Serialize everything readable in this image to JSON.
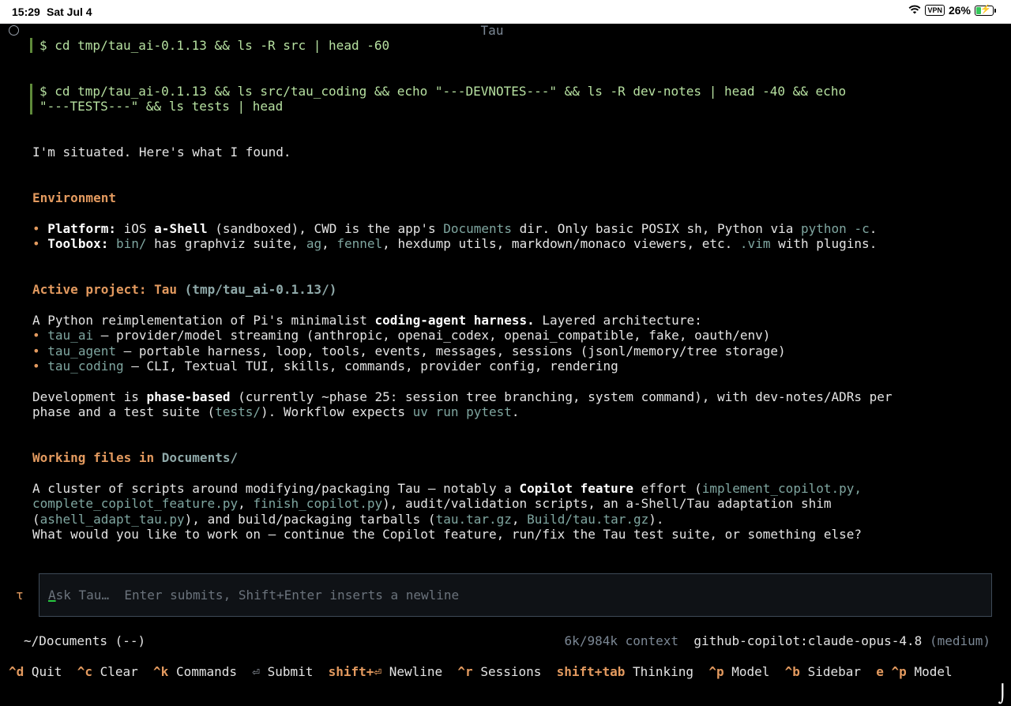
{
  "status_bar": {
    "time": "15:29",
    "date": "Sat Jul 4",
    "vpn": "VPN",
    "battery": "26%"
  },
  "window": {
    "title": "Tau"
  },
  "commands": [
    {
      "line1": "$ cd tmp/tau_ai-0.1.13 && ls -R src | head -60",
      "line2": ""
    },
    {
      "line1": "$ cd tmp/tau_ai-0.1.13 && ls src/tau_coding && echo \"---DEVNOTES---\" && ls -R dev-notes | head -40 && echo",
      "line2": "\"---TESTS---\" && ls tests | head"
    }
  ],
  "intro": "I'm situated. Here's what I found.",
  "environment": {
    "heading": "Environment",
    "platform_label": "Platform:",
    "platform_text_1": "iOS",
    "platform_bold": "a-Shell",
    "platform_text_2": "(sandboxed), CWD is the app's",
    "platform_code_1": "Documents",
    "platform_text_3": "dir. Only basic POSIX sh, Python via",
    "platform_code_2": "python -c",
    "platform_text_4": ".",
    "toolbox_label": "Toolbox:",
    "toolbox_code_1": "bin/",
    "toolbox_text_1": "has graphviz suite,",
    "toolbox_code_2": "ag",
    "toolbox_text_2": ",",
    "toolbox_code_3": "fennel",
    "toolbox_text_3": ", hexdump utils, markdown/monaco viewers, etc.",
    "toolbox_code_4": ".vim",
    "toolbox_text_4": "with plugins."
  },
  "project": {
    "heading": "Active project: Tau",
    "heading_path": "(tmp/tau_ai-0.1.13/)",
    "desc_1": "A Python reimplementation of Pi's minimalist",
    "desc_bold": "coding-agent harness.",
    "desc_2": "Layered architecture:",
    "items": [
      {
        "code": "tau_ai",
        "text": "— provider/model streaming (anthropic, openai_codex, openai_compatible, fake, oauth/env)"
      },
      {
        "code": "tau_agent",
        "text": "— portable harness, loop, tools, events, messages, sessions (jsonl/memory/tree storage)"
      },
      {
        "code": "tau_coding",
        "text": "— CLI, Textual TUI, skills, commands, provider config, rendering"
      }
    ],
    "dev_1": "Development is",
    "dev_bold": "phase-based",
    "dev_2": "(currently ~phase 25: session tree branching, system command), with dev-notes/ADRs per",
    "dev_3": "phase and a test suite (",
    "dev_code_1": "tests/",
    "dev_4": "). Workflow expects",
    "dev_code_2": "uv run pytest",
    "dev_5": "."
  },
  "working": {
    "heading": "Working files in",
    "heading_path": "Documents/",
    "p1_1": "A cluster of scripts around modifying/packaging Tau — notably a",
    "p1_bold": "Copilot feature",
    "p1_2": "effort (",
    "p1_code_1": "implement_copilot.py,",
    "p2_code_1": "complete_copilot_feature.py",
    "p2_1": ",",
    "p2_code_2": "finish_copilot.py",
    "p2_2": "), audit/validation scripts, an a-Shell/Tau adaptation shim",
    "p3_1": "(",
    "p3_code_1": "ashell_adapt_tau.py",
    "p3_2": "), and build/packaging tarballs (",
    "p3_code_2": "tau.tar.gz",
    "p3_3": ",",
    "p3_code_3": "Build/tau.tar.gz",
    "p3_4": ").",
    "question": "What would you like to work on — continue the Copilot feature, run/fix the Tau test suite, or something else?"
  },
  "input": {
    "prompt_symbol": "τ",
    "placeholder_first": "A",
    "placeholder_rest": "sk Tau…  Enter submits, Shift+Enter inserts a newline"
  },
  "footer": {
    "cwd": "~/Documents (--)",
    "context": "6k/984k context",
    "model": "github-copilot:claude-opus-4.8",
    "effort": "(medium)"
  },
  "keybindings": [
    {
      "key": "^d",
      "label": "Quit"
    },
    {
      "key": "^c",
      "label": "Clear"
    },
    {
      "key": "^k",
      "label": "Commands"
    },
    {
      "key": "⏎",
      "label": "Submit"
    },
    {
      "key": "shift+⏎",
      "label": "Newline"
    },
    {
      "key": "^r",
      "label": "Sessions"
    },
    {
      "key": "shift+tab",
      "label": "Thinking"
    },
    {
      "key": "^p",
      "label": "Model"
    },
    {
      "key": "^b",
      "label": "Sidebar"
    },
    {
      "key": "e",
      "label": ""
    },
    {
      "key": "^p",
      "label": "Model"
    }
  ]
}
